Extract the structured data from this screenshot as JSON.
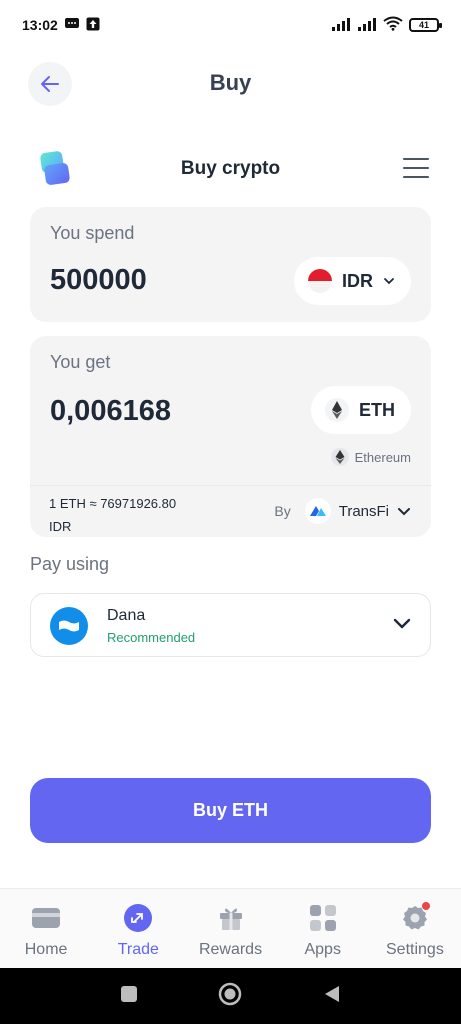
{
  "status_bar": {
    "time": "13:02",
    "battery": "41"
  },
  "header": {
    "title": "Buy"
  },
  "widget": {
    "title": "Buy crypto"
  },
  "spend": {
    "label": "You spend",
    "amount": "500000",
    "currency": "IDR"
  },
  "receive": {
    "label": "You get",
    "amount": "0,006168",
    "asset": "ETH",
    "network": "Ethereum",
    "rate_line1": "1 ETH ≈ 76971926.80",
    "rate_line2": "IDR",
    "by_label": "By",
    "provider": "TransFi"
  },
  "payment": {
    "label": "Pay using",
    "method_name": "Dana",
    "method_tag": "Recommended"
  },
  "cta": {
    "label": "Buy ETH"
  },
  "nav": {
    "items": [
      {
        "label": "Home",
        "icon": "card-icon"
      },
      {
        "label": "Trade",
        "icon": "trade-icon"
      },
      {
        "label": "Rewards",
        "icon": "gift-icon"
      },
      {
        "label": "Apps",
        "icon": "apps-icon"
      },
      {
        "label": "Settings",
        "icon": "gear-icon"
      }
    ],
    "active": "Trade"
  },
  "colors": {
    "accent": "#6366f1",
    "card_bg": "#f4f4f5",
    "success": "#22a06b",
    "dana_blue": "#118ee9"
  }
}
